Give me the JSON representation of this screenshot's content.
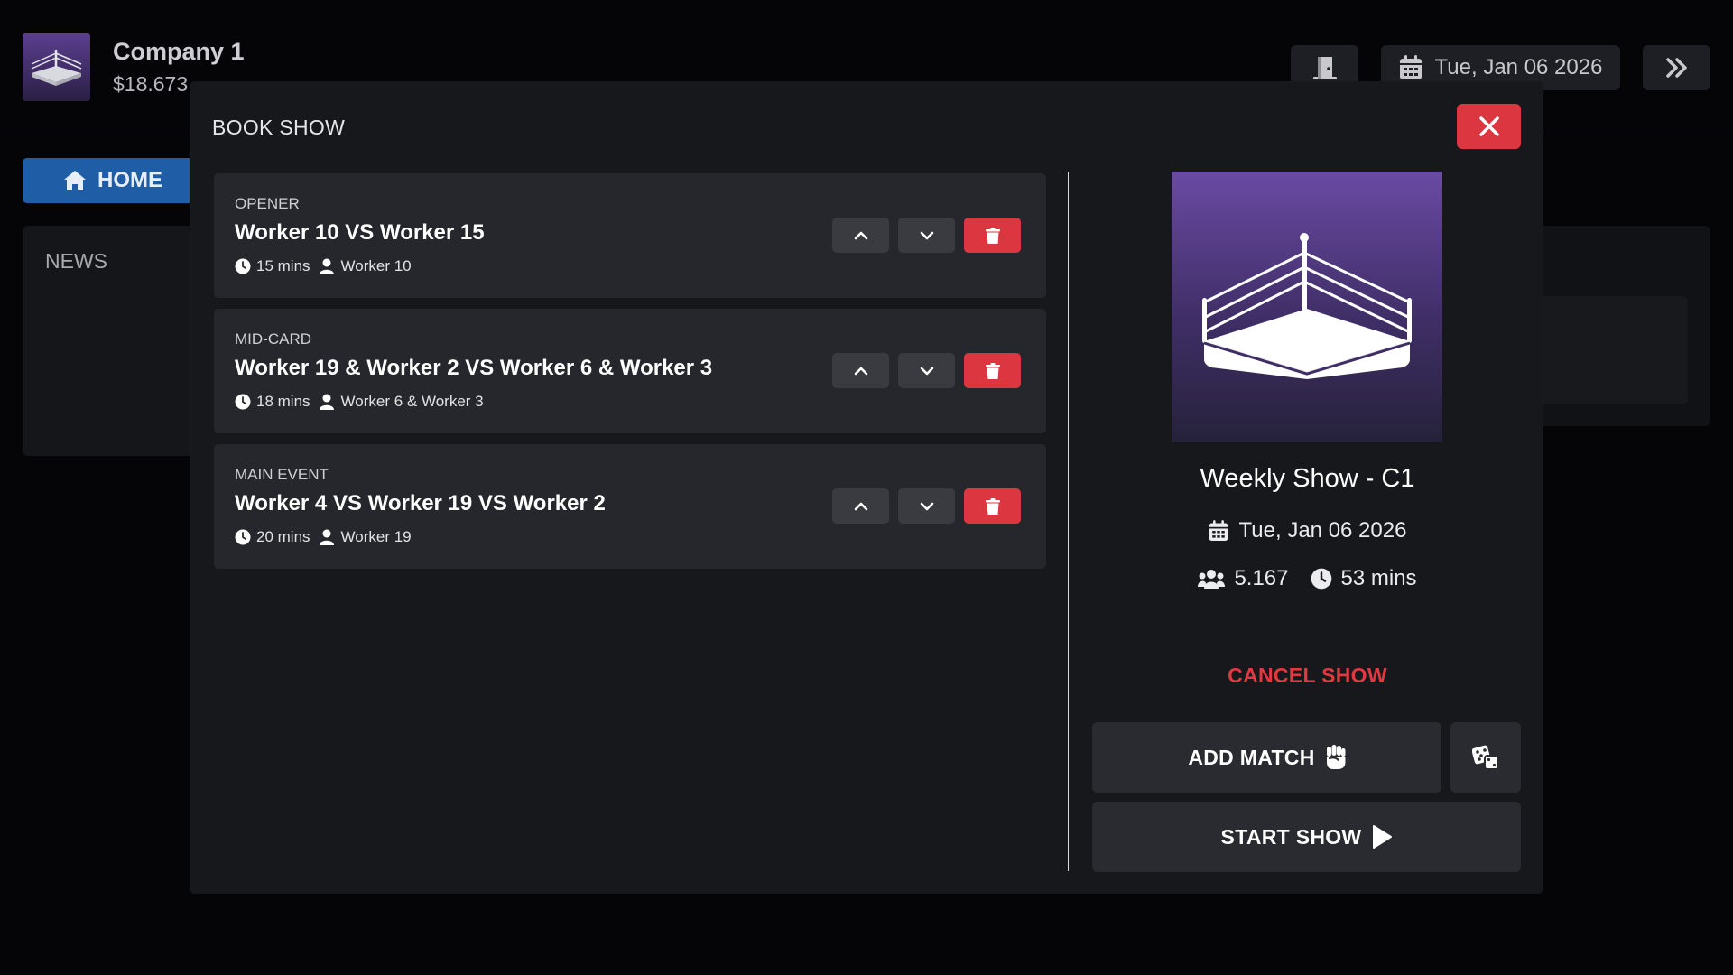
{
  "header": {
    "company_name": "Company 1",
    "money": "$18.673",
    "date": "Tue, Jan 06 2026"
  },
  "nav": {
    "home_label": "HOME"
  },
  "news": {
    "title": "NEWS"
  },
  "modal": {
    "title": "BOOK SHOW",
    "matches": [
      {
        "type": "OPENER",
        "title": "Worker 10 VS Worker 15",
        "duration": "15 mins",
        "winner": "Worker 10"
      },
      {
        "type": "MID-CARD",
        "title": "Worker 19 & Worker 2 VS Worker 6 & Worker 3",
        "duration": "18 mins",
        "winner": "Worker 6 & Worker 3"
      },
      {
        "type": "MAIN EVENT",
        "title": "Worker 4 VS Worker 19 VS Worker 2",
        "duration": "20 mins",
        "winner": "Worker 19"
      }
    ],
    "show": {
      "name": "Weekly Show - C1",
      "date": "Tue, Jan 06 2026",
      "attendance": "5.167",
      "runtime": "53 mins"
    },
    "cancel_label": "CANCEL SHOW",
    "add_match_label": "ADD MATCH",
    "start_show_label": "START SHOW"
  },
  "colors": {
    "accent_red": "#dc3641",
    "home_blue": "#1f5ea6",
    "show_art_purple": "#6a4aa3"
  }
}
